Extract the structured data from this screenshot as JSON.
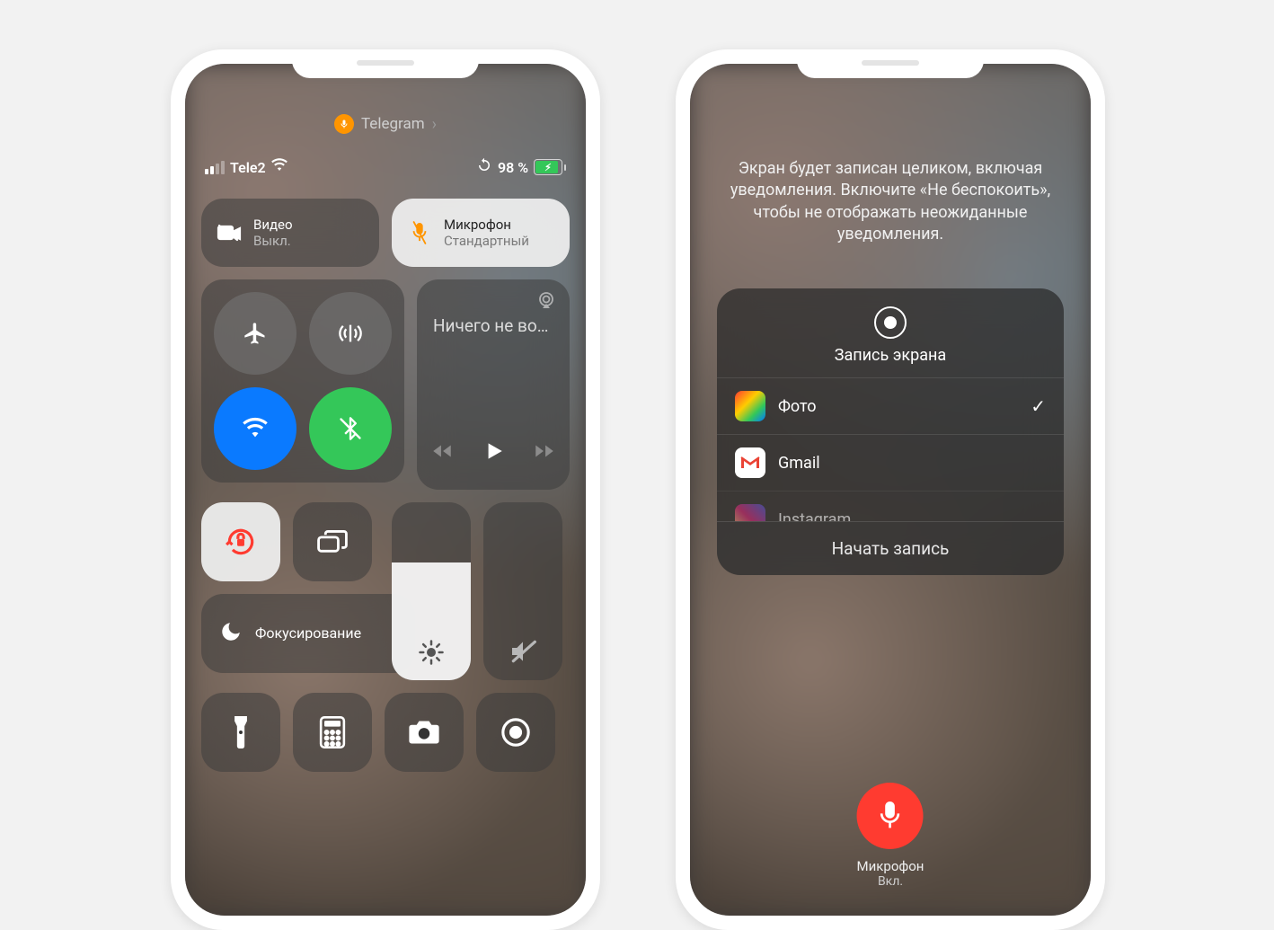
{
  "left": {
    "app_pill": {
      "app": "Telegram"
    },
    "status": {
      "carrier": "Tele2",
      "battery_pct": "98 %"
    },
    "video_tile": {
      "title": "Видео",
      "sub": "Выкл."
    },
    "mic_tile": {
      "title": "Микрофон",
      "sub": "Стандартный"
    },
    "media": {
      "title": "Ничего не во…"
    },
    "focus": {
      "label": "Фокуси­рование"
    }
  },
  "right": {
    "notice": "Экран будет записан целиком, включая уведомления. Включите «Не беспокоить», чтобы не отображать неожиданные уведомления.",
    "sheet_title": "Запись экрана",
    "apps": [
      {
        "name": "Фото",
        "selected": true
      },
      {
        "name": "Gmail",
        "selected": false
      },
      {
        "name": "Instagram",
        "selected": false
      }
    ],
    "start": "Начать запись",
    "mic": {
      "label": "Микрофон",
      "state": "Вкл."
    }
  }
}
